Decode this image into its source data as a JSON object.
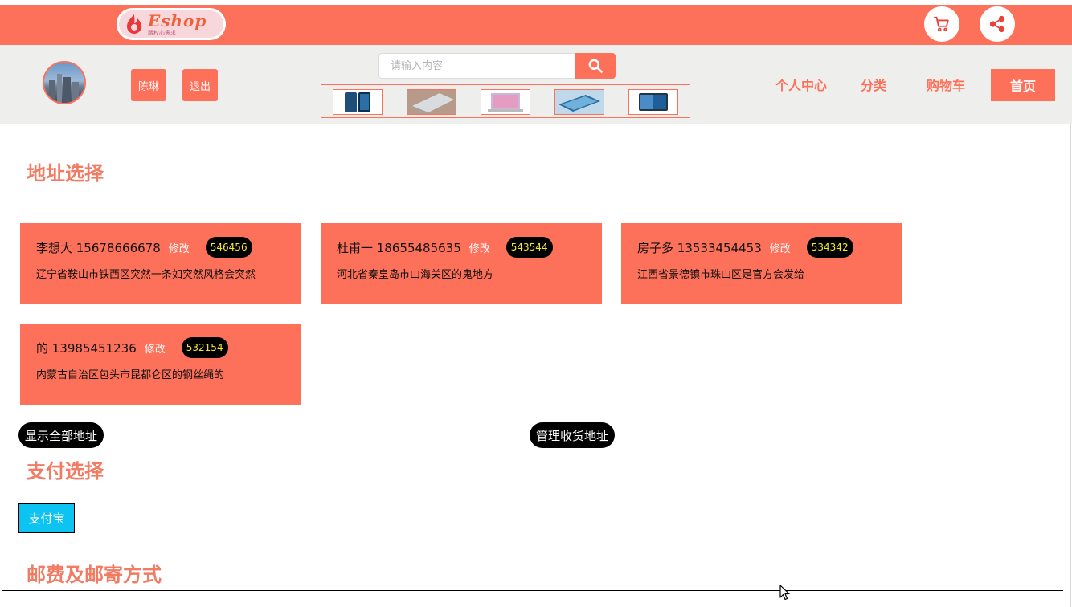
{
  "header": {
    "logo_text": "Eshop",
    "logo_sub": "版权心需求",
    "cart_icon": "cart-icon",
    "share_icon": "share-icon"
  },
  "nav": {
    "user_name": "陈琳",
    "logout_label": "退出",
    "search_placeholder": "请输入内容",
    "search_icon": "search-icon",
    "thumbnails": [
      "phone",
      "laptop-silver",
      "laptop-pink",
      "tablet-blue",
      "tablet-dark"
    ],
    "links": [
      "个人中心",
      "分类",
      "购物车"
    ],
    "home_label": "首页"
  },
  "address": {
    "title": "地址选择",
    "cards": [
      {
        "name_phone": "李想大 15678666678",
        "edit": "修改",
        "zip": "546456",
        "address": "辽宁省鞍山市铁西区突然一条如突然风格会突然"
      },
      {
        "name_phone": "杜甫一 18655485635",
        "edit": "修改",
        "zip": "543544",
        "address": "河北省秦皇岛市山海关区的鬼地方"
      },
      {
        "name_phone": "房子多 13533454453",
        "edit": "修改",
        "zip": "534342",
        "address": "江西省景德镇市珠山区是官方会发给"
      },
      {
        "name_phone": "的 13985451236",
        "edit": "修改",
        "zip": "532154",
        "address": "内蒙古自治区包头市昆都仑区的钢丝绳的"
      }
    ],
    "show_all_label": "显示全部地址",
    "manage_label": "管理收货地址"
  },
  "payment": {
    "title": "支付选择",
    "alipay_label": "支付宝"
  },
  "shipping": {
    "title": "邮费及邮寄方式"
  },
  "colors": {
    "brand": "#fd7059",
    "section_title": "#f27b63",
    "alipay": "#0cc3f2",
    "zip_text": "#f6e92a"
  }
}
